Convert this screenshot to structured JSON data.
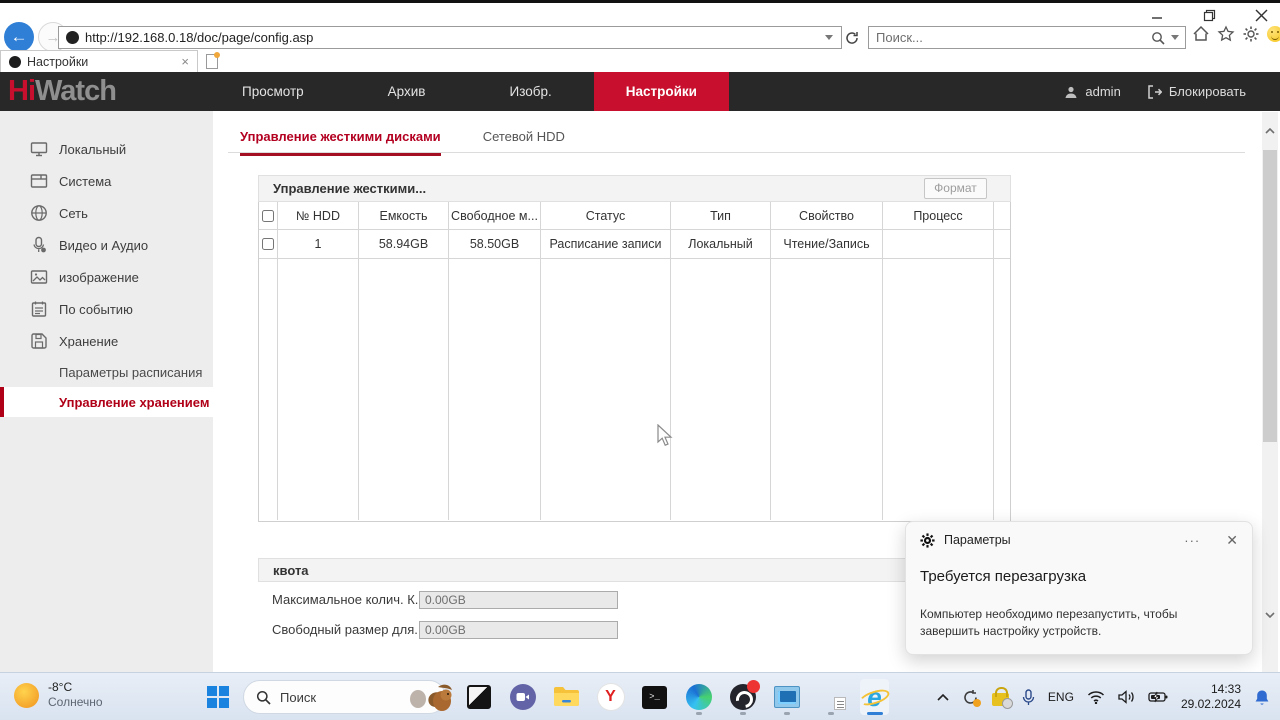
{
  "browser": {
    "url": "http://192.168.0.18/doc/page/config.asp",
    "search_placeholder": "Поиск...",
    "tab_title": "Настройки"
  },
  "navbar": {
    "logo_part1": "Hi",
    "logo_part2": "Watch",
    "items": [
      {
        "label": "Просмотр"
      },
      {
        "label": "Архив"
      },
      {
        "label": "Изобр."
      },
      {
        "label": "Настройки"
      }
    ],
    "user": "admin",
    "lock_label": "Блокировать"
  },
  "sidebar": {
    "items": [
      {
        "label": "Локальный"
      },
      {
        "label": "Система"
      },
      {
        "label": "Сеть"
      },
      {
        "label": "Видео и Аудио"
      },
      {
        "label": "изображение"
      },
      {
        "label": "По событию"
      },
      {
        "label": "Хранение"
      }
    ],
    "subitems": [
      {
        "label": "Параметры расписания"
      },
      {
        "label": "Управление хранением"
      }
    ]
  },
  "content": {
    "tabs": [
      {
        "label": "Управление жесткими дисками"
      },
      {
        "label": "Сетевой HDD"
      }
    ],
    "hdd_panel": {
      "title": "Управление жесткими...",
      "format_button": "Формат",
      "table": {
        "columns": [
          "№ HDD",
          "Емкость",
          "Свободное м...",
          "Статус",
          "Тип",
          "Свойство",
          "Процесс"
        ],
        "rows": [
          {
            "cells": [
              "1",
              "58.94GB",
              "58.50GB",
              "Расписание записи",
              "Локальный",
              "Чтение/Запись",
              ""
            ]
          }
        ]
      }
    },
    "quota_panel": {
      "title": "квота",
      "fields": [
        {
          "label": "Максимальное колич. К...",
          "value": "0.00GB"
        },
        {
          "label": "Свободный размер для...",
          "value": "0.00GB"
        }
      ]
    }
  },
  "toast": {
    "app": "Параметры",
    "more": "···",
    "close": "✕",
    "title": "Требуется перезагрузка",
    "body": "Компьютер необходимо перезапустить, чтобы завершить настройку устройств."
  },
  "taskbar": {
    "weather_temp": "-8°C",
    "weather_condition": "Солнечно",
    "search_label": "Поиск",
    "language": "ENG",
    "time": "14:33",
    "date": "29.02.2024"
  },
  "colors": {
    "brand_red": "#c8102e",
    "active_text_red": "#b30021",
    "navbar_dark": "#282828",
    "sidebar_gray": "#ededed",
    "taskbar_blue": "#dfe8f3"
  }
}
